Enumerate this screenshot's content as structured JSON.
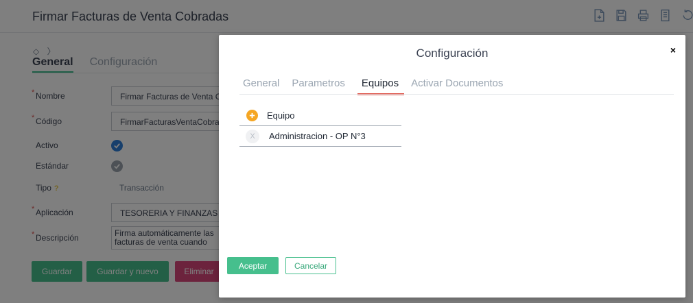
{
  "page": {
    "title": "Firmar Facturas de Venta Cobradas",
    "toolbar": [
      {
        "icon": "new-document-icon"
      },
      {
        "icon": "save-icon"
      },
      {
        "icon": "print-icon"
      },
      {
        "icon": "report-icon"
      },
      {
        "icon": "undo-icon"
      }
    ],
    "crumb_icons": "◇ 〉",
    "tabs": [
      {
        "label": "General",
        "active": true
      },
      {
        "label": "Configuración",
        "active": false
      }
    ],
    "form": {
      "nombre_label": "Nombre",
      "nombre_value": "Firmar Facturas de Venta Cobradas",
      "codigo_label": "Código",
      "codigo_value": "FirmarFacturasVentaCobradas",
      "activo_label": "Activo",
      "estandar_label": "Estándar",
      "tipo_label": "Tipo",
      "tipo_help": "?",
      "tipo_value": "Transacción",
      "aplicacion_label": "Aplicación",
      "aplicacion_value": "TESORERIA Y FINANZAS",
      "descripcion_label": "Descripción",
      "descripcion_value": "Firma automáticamente las facturas de venta cuando",
      "required_mark": "*"
    },
    "buttons": {
      "guardar": "Guardar",
      "guardar_nuevo": "Guardar y nuevo",
      "eliminar": "Eliminar"
    }
  },
  "modal": {
    "title": "Configuración",
    "close": "×",
    "tabs": [
      {
        "label": "General",
        "active": false
      },
      {
        "label": "Parametros",
        "active": false
      },
      {
        "label": "Equipos",
        "active": true
      },
      {
        "label": "Activar Documentos",
        "active": false
      }
    ],
    "team_table": {
      "header": "Equipo",
      "rows": [
        {
          "remove": "X",
          "label": "Administracion - OP N°3"
        }
      ]
    },
    "accept_label": "Aceptar",
    "cancel_label": "Cancelar"
  },
  "colors": {
    "accent_green": "#46bf8d",
    "active_tab_red": "#e05a4f",
    "add_orange": "#f5a623",
    "check_blue": "#2f7fd8",
    "delete_pink": "#d9467a"
  }
}
